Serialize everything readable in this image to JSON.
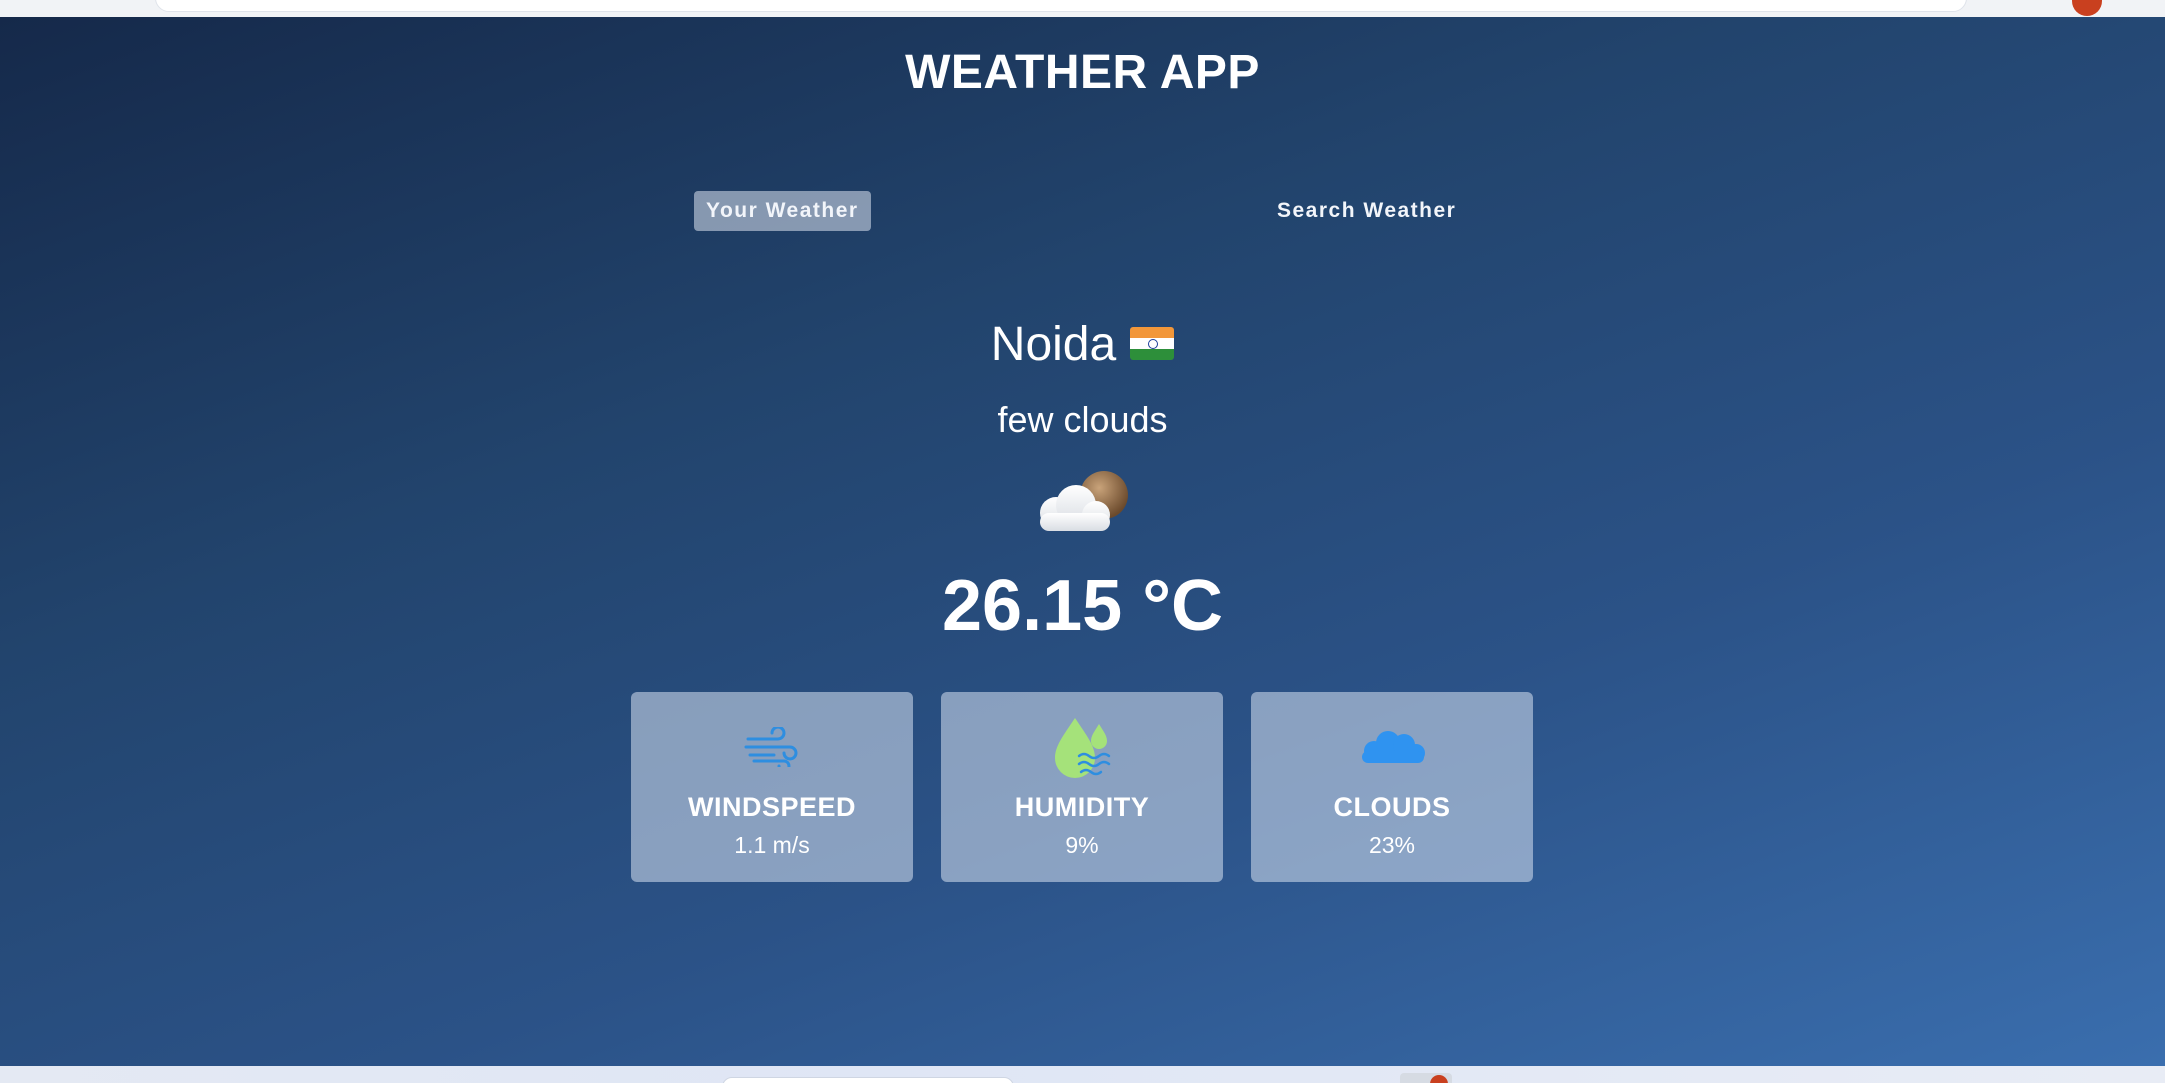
{
  "app": {
    "title": "WEATHER APP",
    "tabs": [
      {
        "label": "Your Weather",
        "active": true
      },
      {
        "label": "Search Weather",
        "active": false
      }
    ]
  },
  "weather": {
    "city": "Noida",
    "country_flag": "india-flag-icon",
    "description": "few clouds",
    "condition_icon": "few-clouds-icon",
    "temperature": "26.15 °C"
  },
  "stats": [
    {
      "label": "WINDSPEED",
      "value": "1.1 m/s",
      "icon": "wind-icon"
    },
    {
      "label": "HUMIDITY",
      "value": "9%",
      "icon": "humidity-icon"
    },
    {
      "label": "CLOUDS",
      "value": "23%",
      "icon": "cloud-icon"
    }
  ],
  "colors": {
    "background_top": "#15294a",
    "background_bottom": "#3a6eae",
    "card_background": "#ced8ec",
    "wind_icon": "#2e8ee0",
    "humidity_icon": "#a5e27a",
    "cloud_icon": "#2f93f0"
  }
}
